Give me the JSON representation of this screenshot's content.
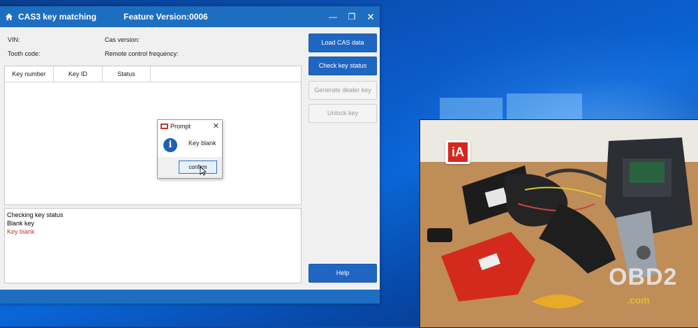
{
  "window": {
    "title": "CAS3 key matching",
    "feature_version": "Feature Version:0006",
    "minimize_icon": "restore-icon",
    "close_icon": "close-icon"
  },
  "fields": {
    "vin_label": "VIN:",
    "tooth_code_label": "Tooth code:",
    "cas_version_label": "Cas version:",
    "remote_freq_label": "Remote control frequency:"
  },
  "table": {
    "columns": [
      "Key number",
      "Key ID",
      "Status"
    ],
    "rows": []
  },
  "log": {
    "lines": [
      "Checking key status",
      "Blank key",
      "Key blank"
    ],
    "colors": [
      "#111111",
      "#111111",
      "#c0392b"
    ]
  },
  "buttons": {
    "load_cas": "Load CAS data",
    "check_key": "Check key status",
    "generate_key": "Generate dealer key",
    "unlock_key": "Unlock key",
    "help": "Help"
  },
  "prompt": {
    "title": "Prompt",
    "message": "Key blank",
    "confirm": "confirm",
    "icon": "info-icon"
  },
  "video": {
    "logo_text": "iA",
    "watermark": "OBD2",
    "watermark_sub": ".com"
  },
  "colors": {
    "accent": "#1f66c2",
    "error_text": "#c0392b"
  }
}
